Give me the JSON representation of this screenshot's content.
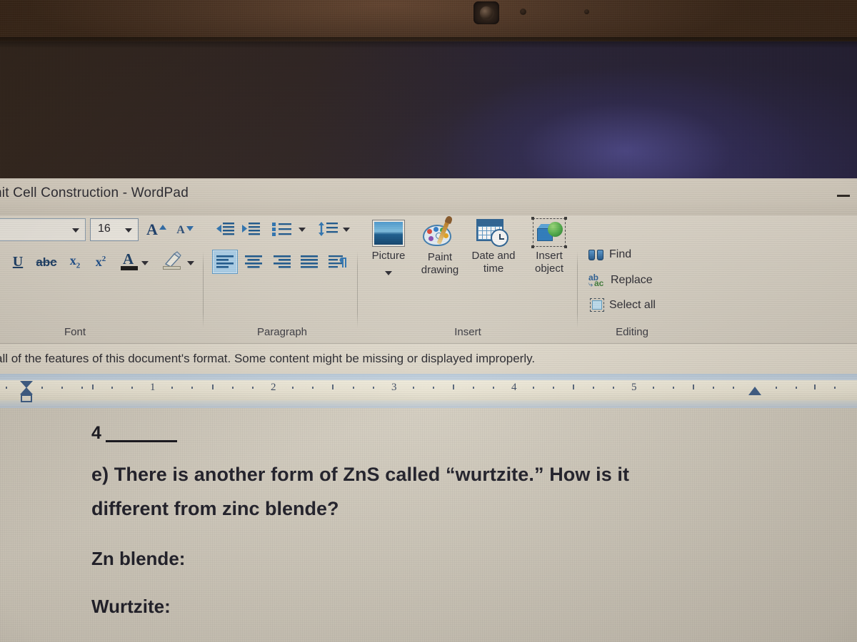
{
  "window": {
    "title": "nit Cell Construction - WordPad",
    "minimize_label": "Minimize"
  },
  "ribbon": {
    "font_group": {
      "label": "Font",
      "font_name_value": "",
      "font_size_value": "16",
      "grow_font": "Grow font",
      "shrink_font": "Shrink font",
      "underline": "U",
      "strikethrough": "abc",
      "subscript": "x",
      "subscript_sub": "2",
      "superscript": "x",
      "superscript_sup": "2",
      "text_color": "A",
      "highlight": "Text highlight color"
    },
    "paragraph_group": {
      "label": "Paragraph",
      "decrease_indent": "Decrease indent",
      "increase_indent": "Increase indent",
      "bullets": "Start a list",
      "line_spacing": "Line spacing",
      "align_left": "Align left",
      "align_center": "Center",
      "align_right": "Align right",
      "justify": "Justify",
      "paragraph_settings": "Paragraph"
    },
    "insert_group": {
      "label": "Insert",
      "items": [
        {
          "caption": "Picture",
          "icon": "picture-icon",
          "has_dropdown": true
        },
        {
          "caption": "Paint\ndrawing",
          "icon": "paint-palette-icon",
          "has_dropdown": false
        },
        {
          "caption": "Date and\ntime",
          "icon": "calendar-clock-icon",
          "has_dropdown": false
        },
        {
          "caption": "Insert\nobject",
          "icon": "object-icon",
          "has_dropdown": false
        }
      ]
    },
    "editing_group": {
      "label": "Editing",
      "items": [
        {
          "label": "Find",
          "icon": "binoculars-icon"
        },
        {
          "label": "Replace",
          "icon": "replace-icon"
        },
        {
          "label": "Select all",
          "icon": "select-all-icon"
        }
      ]
    }
  },
  "compatibility_bar": {
    "message": "all of the features of this document's format. Some content might be missing or displayed improperly."
  },
  "ruler": {
    "numbers": [
      "1",
      "2",
      "3",
      "4",
      "5"
    ],
    "left_indent_marker": "left-indent-marker",
    "right_indent_marker": "right-indent-marker"
  },
  "document": {
    "number_marker": "4",
    "blank_line": "________",
    "lines": [
      "e) There is another form of ZnS called “wurtzite.” How is it",
      "different from zinc blende?",
      "Zn blende:",
      "Wurtzite:"
    ]
  },
  "colors": {
    "accent_blue": "#1d5b92",
    "selected_tool": "#aed4ef",
    "chrome": "#dbd5c9",
    "page": "#cec8bb"
  }
}
